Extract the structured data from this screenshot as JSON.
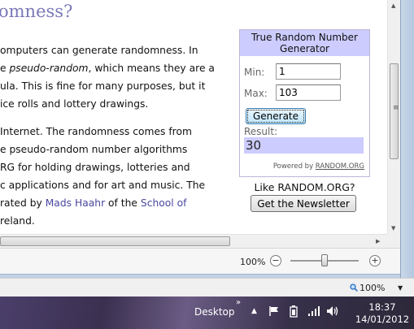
{
  "article": {
    "title": "omness?",
    "lines": [
      {
        "pre": "omputers can generate randomness. In",
        "em": "",
        "post": "",
        "link1": "",
        "mid": "",
        "link2": ""
      },
      {
        "pre": "e ",
        "em": "pseudo-random",
        "post": ", which means they are a",
        "link1": "",
        "mid": "",
        "link2": ""
      },
      {
        "pre": "ula. This is fine for many purposes, but it",
        "em": "",
        "post": "",
        "link1": "",
        "mid": "",
        "link2": ""
      },
      {
        "pre": "ice rolls and lottery drawings.",
        "em": "",
        "post": "",
        "link1": "",
        "mid": "",
        "link2": ""
      },
      {
        "pre": " Internet. The randomness comes from",
        "em": "",
        "post": "",
        "link1": "",
        "mid": "",
        "link2": ""
      },
      {
        "pre": "e pseudo-random number algorithms",
        "em": "",
        "post": "",
        "link1": "",
        "mid": "",
        "link2": ""
      },
      {
        "pre": "RG for holding drawings, lotteries and",
        "em": "",
        "post": "",
        "link1": "",
        "mid": "",
        "link2": ""
      },
      {
        "pre": "c applications and for art and music. The",
        "em": "",
        "post": "",
        "link1": "",
        "mid": "",
        "link2": ""
      },
      {
        "pre": "rated by ",
        "em": "",
        "post": "",
        "link1": "Mads Haahr",
        "mid": " of the ",
        "link2": "School of"
      },
      {
        "pre": "reland.",
        "em": "",
        "post": "",
        "link1": "",
        "mid": "",
        "link2": ""
      }
    ]
  },
  "widget": {
    "title": "True Random Number Generator",
    "min_label": "Min:",
    "min_value": "1",
    "max_label": "Max:",
    "max_value": "103",
    "generate_label": "Generate",
    "result_label": "Result:",
    "result_value": "30",
    "powered_by": "Powered by ",
    "powered_link": "RANDOM.ORG"
  },
  "newsletter": {
    "prompt": "Like RANDOM.ORG?",
    "button_label": "Get the Newsletter"
  },
  "zoom_controls": {
    "percent": "100%",
    "minus": "−",
    "plus": "+",
    "slider_level": 0.5
  },
  "statusbar": {
    "zoom": "100%"
  },
  "taskbar": {
    "desktop_label": "Desktop",
    "chevron": "»",
    "time": "18:37",
    "date": "14/01/2012"
  },
  "icons": {
    "tray": [
      "show-hidden-icons-icon",
      "action-center-flag-icon",
      "battery-icon",
      "network-signal-icon",
      "volume-icon"
    ]
  }
}
